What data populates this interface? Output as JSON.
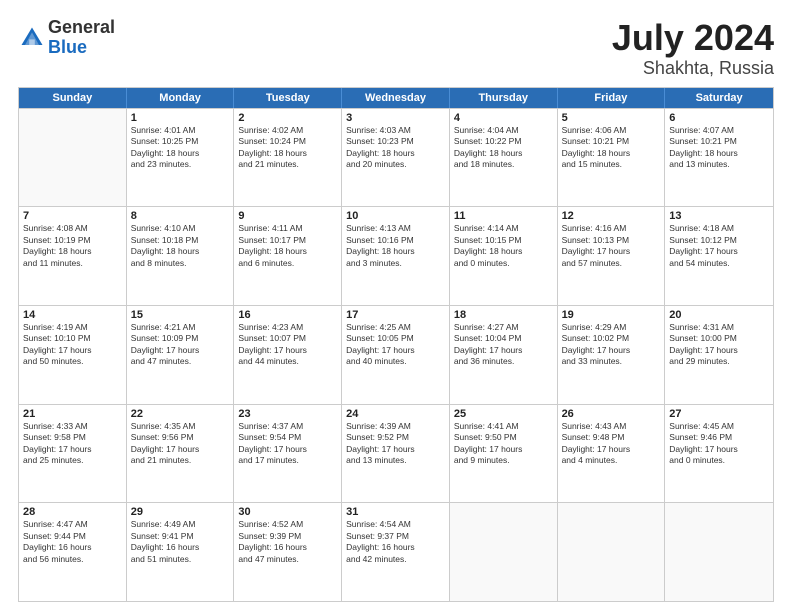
{
  "logo": {
    "general": "General",
    "blue": "Blue"
  },
  "title": {
    "month": "July 2024",
    "location": "Shakhta, Russia"
  },
  "days_header": [
    "Sunday",
    "Monday",
    "Tuesday",
    "Wednesday",
    "Thursday",
    "Friday",
    "Saturday"
  ],
  "weeks": [
    [
      {
        "day": "",
        "info": ""
      },
      {
        "day": "1",
        "info": "Sunrise: 4:01 AM\nSunset: 10:25 PM\nDaylight: 18 hours\nand 23 minutes."
      },
      {
        "day": "2",
        "info": "Sunrise: 4:02 AM\nSunset: 10:24 PM\nDaylight: 18 hours\nand 21 minutes."
      },
      {
        "day": "3",
        "info": "Sunrise: 4:03 AM\nSunset: 10:23 PM\nDaylight: 18 hours\nand 20 minutes."
      },
      {
        "day": "4",
        "info": "Sunrise: 4:04 AM\nSunset: 10:22 PM\nDaylight: 18 hours\nand 18 minutes."
      },
      {
        "day": "5",
        "info": "Sunrise: 4:06 AM\nSunset: 10:21 PM\nDaylight: 18 hours\nand 15 minutes."
      },
      {
        "day": "6",
        "info": "Sunrise: 4:07 AM\nSunset: 10:21 PM\nDaylight: 18 hours\nand 13 minutes."
      }
    ],
    [
      {
        "day": "7",
        "info": "Sunrise: 4:08 AM\nSunset: 10:19 PM\nDaylight: 18 hours\nand 11 minutes."
      },
      {
        "day": "8",
        "info": "Sunrise: 4:10 AM\nSunset: 10:18 PM\nDaylight: 18 hours\nand 8 minutes."
      },
      {
        "day": "9",
        "info": "Sunrise: 4:11 AM\nSunset: 10:17 PM\nDaylight: 18 hours\nand 6 minutes."
      },
      {
        "day": "10",
        "info": "Sunrise: 4:13 AM\nSunset: 10:16 PM\nDaylight: 18 hours\nand 3 minutes."
      },
      {
        "day": "11",
        "info": "Sunrise: 4:14 AM\nSunset: 10:15 PM\nDaylight: 18 hours\nand 0 minutes."
      },
      {
        "day": "12",
        "info": "Sunrise: 4:16 AM\nSunset: 10:13 PM\nDaylight: 17 hours\nand 57 minutes."
      },
      {
        "day": "13",
        "info": "Sunrise: 4:18 AM\nSunset: 10:12 PM\nDaylight: 17 hours\nand 54 minutes."
      }
    ],
    [
      {
        "day": "14",
        "info": "Sunrise: 4:19 AM\nSunset: 10:10 PM\nDaylight: 17 hours\nand 50 minutes."
      },
      {
        "day": "15",
        "info": "Sunrise: 4:21 AM\nSunset: 10:09 PM\nDaylight: 17 hours\nand 47 minutes."
      },
      {
        "day": "16",
        "info": "Sunrise: 4:23 AM\nSunset: 10:07 PM\nDaylight: 17 hours\nand 44 minutes."
      },
      {
        "day": "17",
        "info": "Sunrise: 4:25 AM\nSunset: 10:05 PM\nDaylight: 17 hours\nand 40 minutes."
      },
      {
        "day": "18",
        "info": "Sunrise: 4:27 AM\nSunset: 10:04 PM\nDaylight: 17 hours\nand 36 minutes."
      },
      {
        "day": "19",
        "info": "Sunrise: 4:29 AM\nSunset: 10:02 PM\nDaylight: 17 hours\nand 33 minutes."
      },
      {
        "day": "20",
        "info": "Sunrise: 4:31 AM\nSunset: 10:00 PM\nDaylight: 17 hours\nand 29 minutes."
      }
    ],
    [
      {
        "day": "21",
        "info": "Sunrise: 4:33 AM\nSunset: 9:58 PM\nDaylight: 17 hours\nand 25 minutes."
      },
      {
        "day": "22",
        "info": "Sunrise: 4:35 AM\nSunset: 9:56 PM\nDaylight: 17 hours\nand 21 minutes."
      },
      {
        "day": "23",
        "info": "Sunrise: 4:37 AM\nSunset: 9:54 PM\nDaylight: 17 hours\nand 17 minutes."
      },
      {
        "day": "24",
        "info": "Sunrise: 4:39 AM\nSunset: 9:52 PM\nDaylight: 17 hours\nand 13 minutes."
      },
      {
        "day": "25",
        "info": "Sunrise: 4:41 AM\nSunset: 9:50 PM\nDaylight: 17 hours\nand 9 minutes."
      },
      {
        "day": "26",
        "info": "Sunrise: 4:43 AM\nSunset: 9:48 PM\nDaylight: 17 hours\nand 4 minutes."
      },
      {
        "day": "27",
        "info": "Sunrise: 4:45 AM\nSunset: 9:46 PM\nDaylight: 17 hours\nand 0 minutes."
      }
    ],
    [
      {
        "day": "28",
        "info": "Sunrise: 4:47 AM\nSunset: 9:44 PM\nDaylight: 16 hours\nand 56 minutes."
      },
      {
        "day": "29",
        "info": "Sunrise: 4:49 AM\nSunset: 9:41 PM\nDaylight: 16 hours\nand 51 minutes."
      },
      {
        "day": "30",
        "info": "Sunrise: 4:52 AM\nSunset: 9:39 PM\nDaylight: 16 hours\nand 47 minutes."
      },
      {
        "day": "31",
        "info": "Sunrise: 4:54 AM\nSunset: 9:37 PM\nDaylight: 16 hours\nand 42 minutes."
      },
      {
        "day": "",
        "info": ""
      },
      {
        "day": "",
        "info": ""
      },
      {
        "day": "",
        "info": ""
      }
    ]
  ]
}
